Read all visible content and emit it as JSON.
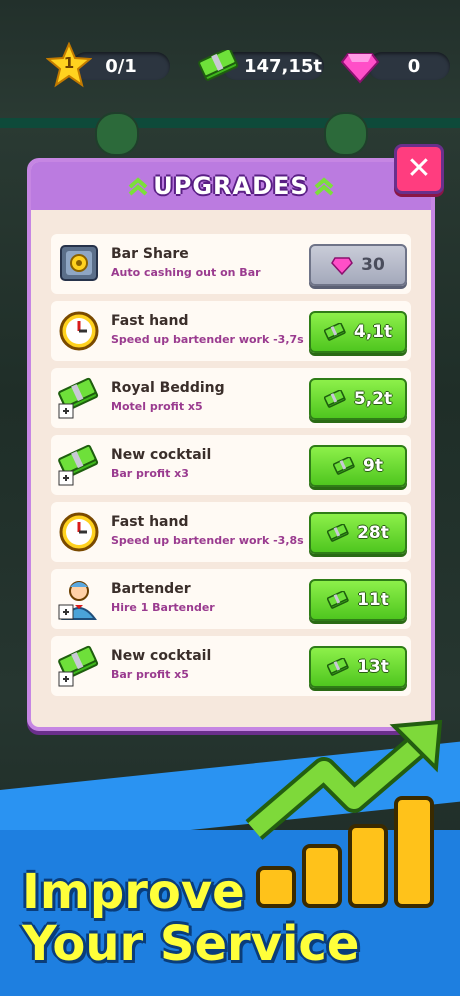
{
  "top_bar": {
    "star_level": "1",
    "stars": "0/1",
    "cash": "147,15t",
    "gems": "0"
  },
  "panel": {
    "title": "UPGRADES",
    "close_label": "✕"
  },
  "upgrades": [
    {
      "name": "Bar Share",
      "desc": "Auto cashing out on Bar",
      "price": "30",
      "currency": "gem",
      "icon": "safe-icon"
    },
    {
      "name": "Fast hand",
      "desc": "Speed up bartender work -3,7s",
      "price": "4,1t",
      "currency": "cash",
      "icon": "clock-icon"
    },
    {
      "name": "Royal Bedding",
      "desc": "Motel profit x5",
      "price": "5,2t",
      "currency": "cash",
      "icon": "cash-plus-icon"
    },
    {
      "name": "New cocktail",
      "desc": "Bar profit x3",
      "price": "9t",
      "currency": "cash",
      "icon": "cash-plus-icon"
    },
    {
      "name": "Fast hand",
      "desc": "Speed up bartender work -3,8s",
      "price": "28t",
      "currency": "cash",
      "icon": "clock-icon"
    },
    {
      "name": "Bartender",
      "desc": "Hire 1 Bartender",
      "price": "11t",
      "currency": "cash",
      "icon": "bartender-icon"
    },
    {
      "name": "New cocktail",
      "desc": "Bar profit x5",
      "price": "13t",
      "currency": "cash",
      "icon": "cash-plus-icon"
    }
  ],
  "promo": {
    "line1": "Improve",
    "line2": "Your Service"
  },
  "colors": {
    "panel_header": "#bb7be0",
    "buy_green": "#4fc61f",
    "close_pink": "#ff3d7f",
    "headline_yellow": "#ffff3a"
  }
}
